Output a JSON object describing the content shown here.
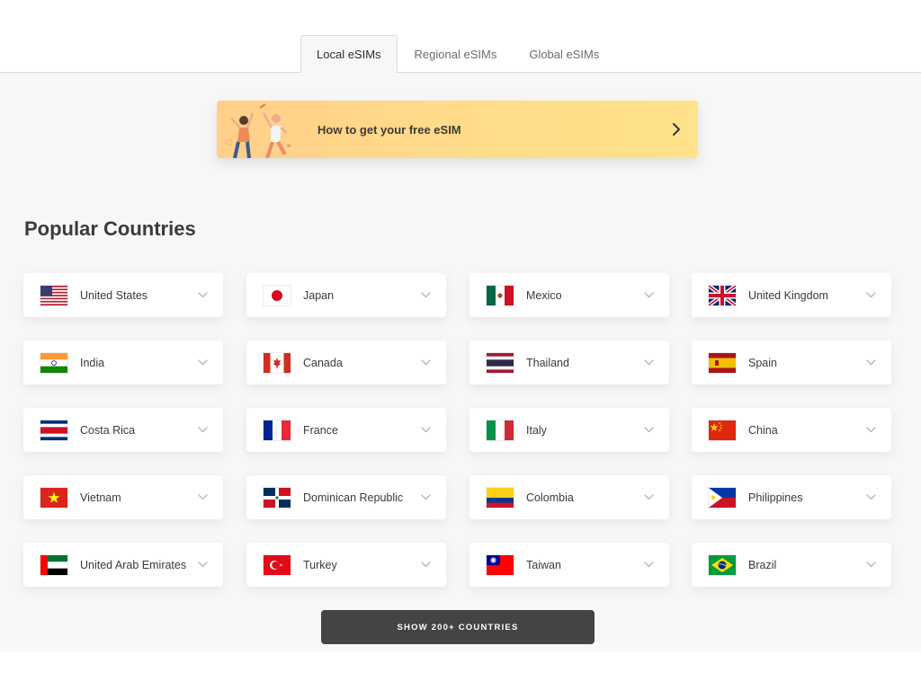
{
  "tabs": [
    {
      "label": "Local eSIMs",
      "active": true
    },
    {
      "label": "Regional eSIMs",
      "active": false
    },
    {
      "label": "Global eSIMs",
      "active": false
    }
  ],
  "banner": {
    "label": "How to get your free eSIM",
    "icon": "chevron-right-icon"
  },
  "section": {
    "title": "Popular Countries"
  },
  "countries": [
    {
      "name": "United States",
      "flag": "us"
    },
    {
      "name": "Japan",
      "flag": "jp"
    },
    {
      "name": "Mexico",
      "flag": "mx"
    },
    {
      "name": "United Kingdom",
      "flag": "gb"
    },
    {
      "name": "India",
      "flag": "in"
    },
    {
      "name": "Canada",
      "flag": "ca"
    },
    {
      "name": "Thailand",
      "flag": "th"
    },
    {
      "name": "Spain",
      "flag": "es"
    },
    {
      "name": "Costa Rica",
      "flag": "cr"
    },
    {
      "name": "France",
      "flag": "fr"
    },
    {
      "name": "Italy",
      "flag": "it"
    },
    {
      "name": "China",
      "flag": "cn"
    },
    {
      "name": "Vietnam",
      "flag": "vn"
    },
    {
      "name": "Dominican Republic",
      "flag": "do"
    },
    {
      "name": "Colombia",
      "flag": "co"
    },
    {
      "name": "Philippines",
      "flag": "ph"
    },
    {
      "name": "United Arab Emirates",
      "flag": "ae"
    },
    {
      "name": "Turkey",
      "flag": "tr"
    },
    {
      "name": "Taiwan",
      "flag": "tw"
    },
    {
      "name": "Brazil",
      "flag": "br"
    }
  ],
  "show_more": {
    "label": "SHOW 200+ COUNTRIES"
  },
  "colors": {
    "accent_dark": "#444444",
    "banner_start": "#ffcf8a",
    "banner_end": "#ffe28a",
    "background": "#f7f7f7"
  }
}
